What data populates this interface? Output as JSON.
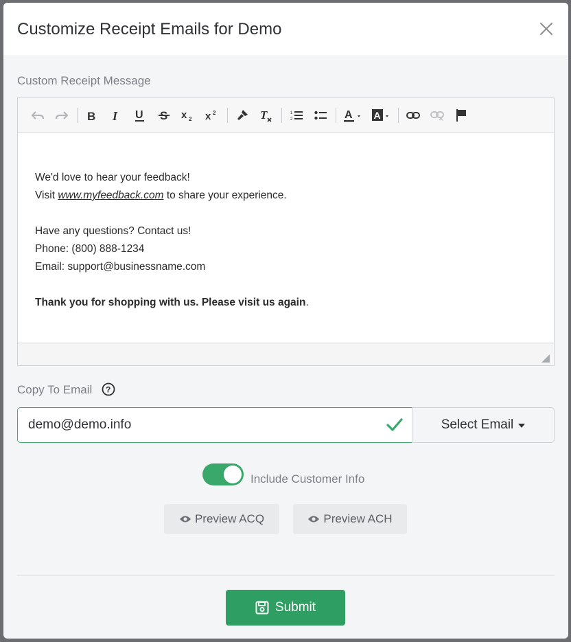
{
  "modal": {
    "title": "Customize Receipt Emails for Demo",
    "close_icon": "close-icon"
  },
  "editor": {
    "label": "Custom Receipt Message",
    "toolbar": [
      {
        "name": "undo-icon"
      },
      {
        "name": "redo-icon"
      },
      {
        "name": "bold-icon"
      },
      {
        "name": "italic-icon"
      },
      {
        "name": "underline-icon"
      },
      {
        "name": "strikethrough-icon"
      },
      {
        "name": "subscript-icon"
      },
      {
        "name": "superscript-icon"
      },
      {
        "name": "format-painter-icon"
      },
      {
        "name": "clear-format-icon"
      },
      {
        "name": "ordered-list-icon"
      },
      {
        "name": "unordered-list-icon"
      },
      {
        "name": "text-color-icon"
      },
      {
        "name": "background-color-icon"
      },
      {
        "name": "link-icon"
      },
      {
        "name": "unlink-icon"
      },
      {
        "name": "anchor-flag-icon"
      }
    ],
    "content": {
      "line1": "We'd love to hear your feedback!",
      "line2_prefix": "Visit ",
      "line2_link": "www.myfeedback.com",
      "line2_suffix": " to share your experience.",
      "line3": "Have any questions? Contact us!",
      "line4": "Phone: (800) 888-1234",
      "line5": "Email: support@businessname.com",
      "line6_bold": "Thank you for shopping with us. Please visit us again",
      "line6_tail": "."
    }
  },
  "copy_to_email": {
    "label": "Copy To Email",
    "value": "demo@demo.info",
    "select_label": "Select Email"
  },
  "include_customer_info": {
    "label": "Include Customer Info",
    "enabled": true
  },
  "preview": {
    "acq_label": "Preview ACQ",
    "ach_label": "Preview ACH"
  },
  "submit": {
    "label": "Submit"
  },
  "colors": {
    "accent": "#3aa86a",
    "submit": "#2f9e63"
  }
}
